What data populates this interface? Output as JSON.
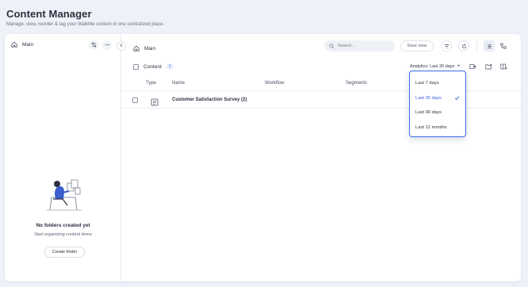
{
  "header": {
    "title": "Content Manager",
    "subtitle": "Manage, view, reorder & tag your WalkMe content in one centralized place."
  },
  "sidebar": {
    "breadcrumb": "Main",
    "empty_title": "No folders created yet",
    "empty_subtitle": "Start organizing content items",
    "create_folder_label": "Create folder"
  },
  "main": {
    "breadcrumb": "Main",
    "search_placeholder": "Search...",
    "save_view_label": "Save view",
    "content_label": "Content",
    "content_count": "1",
    "analytics_label": "Analytics: Last 30 days",
    "columns": [
      "Type",
      "Name",
      "Workflow",
      "Segments"
    ],
    "rows": [
      {
        "name": "Customer Satisfaction Survey (2)",
        "type_icon": "survey-icon"
      }
    ]
  },
  "analytics_dropdown": {
    "options": [
      "Last 7 days",
      "Last 30 days",
      "Last 90 days",
      "Last 12 months"
    ],
    "selected": "Last 30 days"
  },
  "colors": {
    "accent": "#3b62e0",
    "background": "#eef1f8",
    "card": "#ffffff"
  }
}
